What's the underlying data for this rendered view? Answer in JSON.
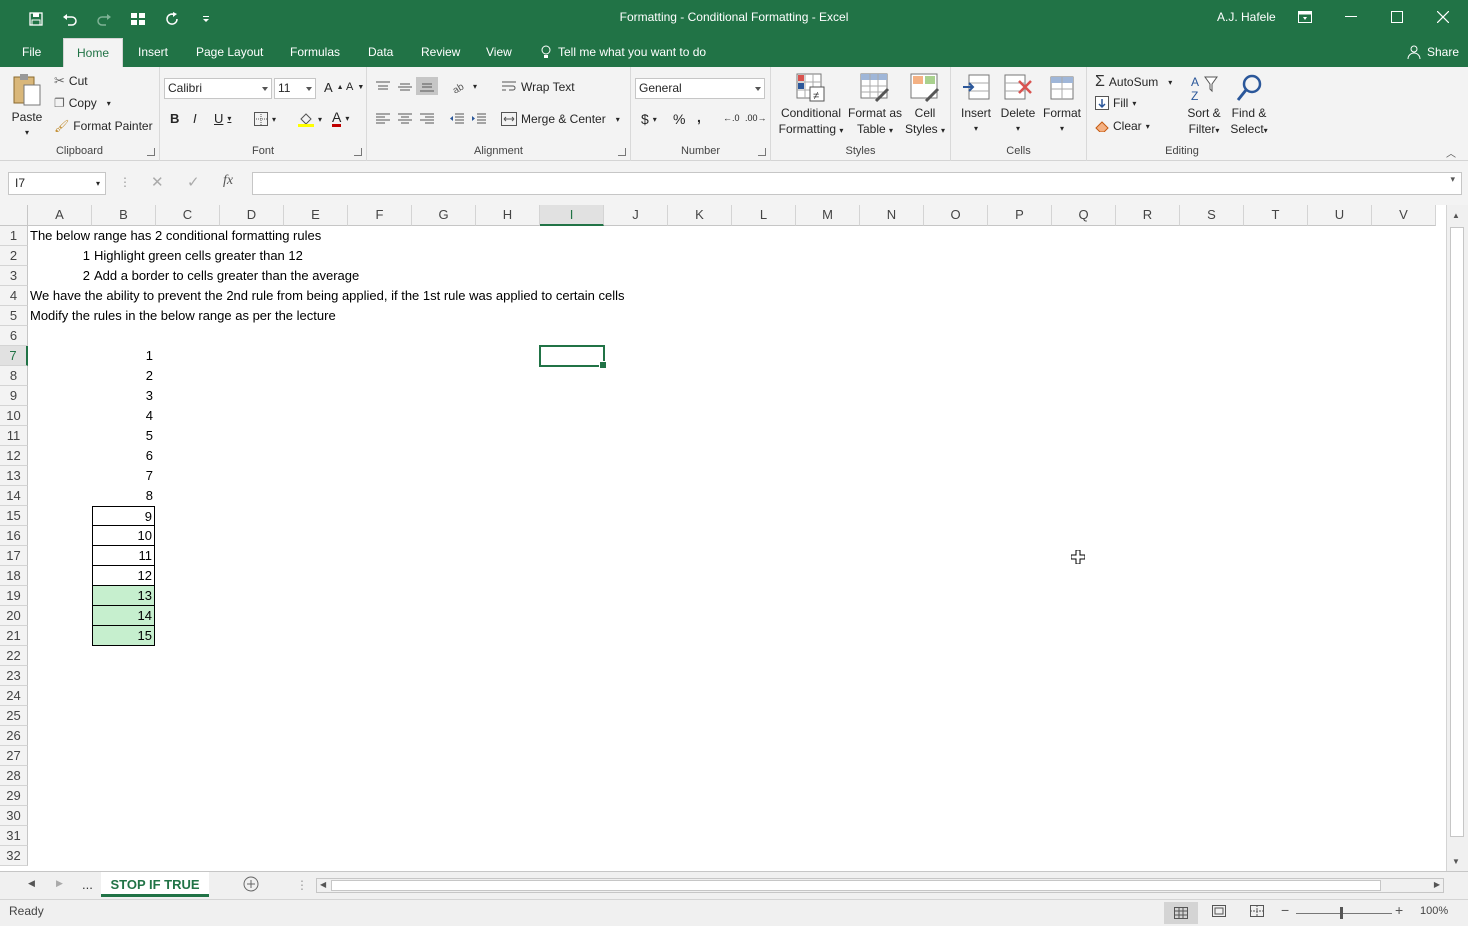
{
  "window": {
    "title": "Formatting - Conditional Formatting  -  Excel",
    "user": "A.J. Hafele"
  },
  "tabs": [
    {
      "label": "File"
    },
    {
      "label": "Home"
    },
    {
      "label": "Insert"
    },
    {
      "label": "Page Layout"
    },
    {
      "label": "Formulas"
    },
    {
      "label": "Data"
    },
    {
      "label": "Review"
    },
    {
      "label": "View"
    }
  ],
  "tellme": "Tell me what you want to do",
  "share": "Share",
  "ribbon": {
    "clipboard": {
      "label": "Clipboard",
      "paste": "Paste",
      "cut": "Cut",
      "copy": "Copy",
      "format_painter": "Format Painter"
    },
    "font": {
      "label": "Font",
      "name": "Calibri",
      "size": "11"
    },
    "alignment": {
      "label": "Alignment",
      "wrap": "Wrap Text",
      "merge": "Merge & Center"
    },
    "number": {
      "label": "Number",
      "format": "General"
    },
    "styles": {
      "label": "Styles",
      "cond1": "Conditional",
      "cond2": "Formatting",
      "fat1": "Format as",
      "fat2": "Table",
      "cs1": "Cell",
      "cs2": "Styles"
    },
    "cells": {
      "label": "Cells",
      "insert": "Insert",
      "delete": "Delete",
      "format": "Format"
    },
    "editing": {
      "label": "Editing",
      "autosum": "AutoSum",
      "fill": "Fill",
      "clear": "Clear",
      "sort1": "Sort &",
      "sort2": "Filter",
      "find1": "Find &",
      "find2": "Select"
    }
  },
  "namebox": "I7",
  "columns": [
    "A",
    "B",
    "C",
    "D",
    "E",
    "F",
    "G",
    "H",
    "I",
    "J",
    "K",
    "L",
    "M",
    "N",
    "O",
    "P",
    "Q",
    "R",
    "S",
    "T",
    "U",
    "V"
  ],
  "rows": [
    "1",
    "2",
    "3",
    "4",
    "5",
    "6",
    "7",
    "8",
    "9",
    "10",
    "11",
    "12",
    "13",
    "14",
    "15",
    "16",
    "17",
    "18",
    "19",
    "20",
    "21",
    "22",
    "23",
    "24",
    "25",
    "26",
    "27",
    "28",
    "29",
    "30",
    "31",
    "32"
  ],
  "cells": {
    "a1": "The below range has 2 conditional formatting rules",
    "a2n": "1",
    "a2": "Highlight green cells greater than 12",
    "a3n": "2",
    "a3": "Add a border to cells greater than the average",
    "a4": "We have the ability to prevent the 2nd rule from being applied, if the 1st rule was applied to certain cells",
    "a5": "Modify the rules in the below range as per the lecture"
  },
  "values": [
    "1",
    "2",
    "3",
    "4",
    "5",
    "6",
    "7",
    "8",
    "9",
    "10",
    "11",
    "12",
    "13",
    "14",
    "15"
  ],
  "colors": {
    "green_fill": "#c6efce",
    "accent": "#217346"
  },
  "sheet": {
    "ellipsis": "...",
    "active": "STOP IF TRUE"
  },
  "status": {
    "ready": "Ready",
    "zoom": "100%"
  }
}
